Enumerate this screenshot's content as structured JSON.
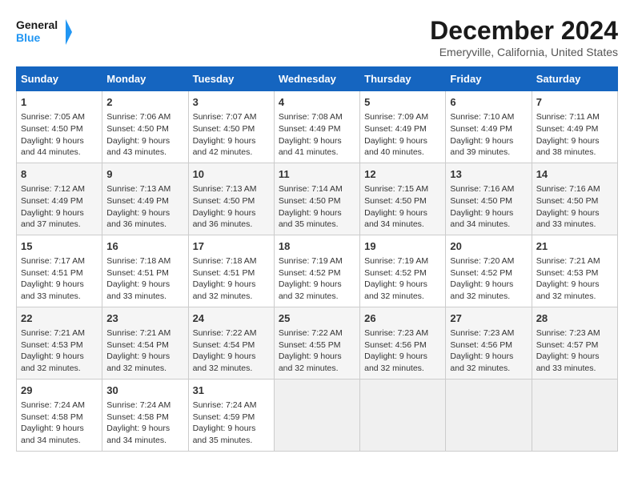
{
  "header": {
    "logo_line1": "General",
    "logo_line2": "Blue",
    "title": "December 2024",
    "subtitle": "Emeryville, California, United States"
  },
  "columns": [
    "Sunday",
    "Monday",
    "Tuesday",
    "Wednesday",
    "Thursday",
    "Friday",
    "Saturday"
  ],
  "weeks": [
    [
      {
        "day": "1",
        "info": "Sunrise: 7:05 AM\nSunset: 4:50 PM\nDaylight: 9 hours\nand 44 minutes."
      },
      {
        "day": "2",
        "info": "Sunrise: 7:06 AM\nSunset: 4:50 PM\nDaylight: 9 hours\nand 43 minutes."
      },
      {
        "day": "3",
        "info": "Sunrise: 7:07 AM\nSunset: 4:50 PM\nDaylight: 9 hours\nand 42 minutes."
      },
      {
        "day": "4",
        "info": "Sunrise: 7:08 AM\nSunset: 4:49 PM\nDaylight: 9 hours\nand 41 minutes."
      },
      {
        "day": "5",
        "info": "Sunrise: 7:09 AM\nSunset: 4:49 PM\nDaylight: 9 hours\nand 40 minutes."
      },
      {
        "day": "6",
        "info": "Sunrise: 7:10 AM\nSunset: 4:49 PM\nDaylight: 9 hours\nand 39 minutes."
      },
      {
        "day": "7",
        "info": "Sunrise: 7:11 AM\nSunset: 4:49 PM\nDaylight: 9 hours\nand 38 minutes."
      }
    ],
    [
      {
        "day": "8",
        "info": "Sunrise: 7:12 AM\nSunset: 4:49 PM\nDaylight: 9 hours\nand 37 minutes."
      },
      {
        "day": "9",
        "info": "Sunrise: 7:13 AM\nSunset: 4:49 PM\nDaylight: 9 hours\nand 36 minutes."
      },
      {
        "day": "10",
        "info": "Sunrise: 7:13 AM\nSunset: 4:50 PM\nDaylight: 9 hours\nand 36 minutes."
      },
      {
        "day": "11",
        "info": "Sunrise: 7:14 AM\nSunset: 4:50 PM\nDaylight: 9 hours\nand 35 minutes."
      },
      {
        "day": "12",
        "info": "Sunrise: 7:15 AM\nSunset: 4:50 PM\nDaylight: 9 hours\nand 34 minutes."
      },
      {
        "day": "13",
        "info": "Sunrise: 7:16 AM\nSunset: 4:50 PM\nDaylight: 9 hours\nand 34 minutes."
      },
      {
        "day": "14",
        "info": "Sunrise: 7:16 AM\nSunset: 4:50 PM\nDaylight: 9 hours\nand 33 minutes."
      }
    ],
    [
      {
        "day": "15",
        "info": "Sunrise: 7:17 AM\nSunset: 4:51 PM\nDaylight: 9 hours\nand 33 minutes."
      },
      {
        "day": "16",
        "info": "Sunrise: 7:18 AM\nSunset: 4:51 PM\nDaylight: 9 hours\nand 33 minutes."
      },
      {
        "day": "17",
        "info": "Sunrise: 7:18 AM\nSunset: 4:51 PM\nDaylight: 9 hours\nand 32 minutes."
      },
      {
        "day": "18",
        "info": "Sunrise: 7:19 AM\nSunset: 4:52 PM\nDaylight: 9 hours\nand 32 minutes."
      },
      {
        "day": "19",
        "info": "Sunrise: 7:19 AM\nSunset: 4:52 PM\nDaylight: 9 hours\nand 32 minutes."
      },
      {
        "day": "20",
        "info": "Sunrise: 7:20 AM\nSunset: 4:52 PM\nDaylight: 9 hours\nand 32 minutes."
      },
      {
        "day": "21",
        "info": "Sunrise: 7:21 AM\nSunset: 4:53 PM\nDaylight: 9 hours\nand 32 minutes."
      }
    ],
    [
      {
        "day": "22",
        "info": "Sunrise: 7:21 AM\nSunset: 4:53 PM\nDaylight: 9 hours\nand 32 minutes."
      },
      {
        "day": "23",
        "info": "Sunrise: 7:21 AM\nSunset: 4:54 PM\nDaylight: 9 hours\nand 32 minutes."
      },
      {
        "day": "24",
        "info": "Sunrise: 7:22 AM\nSunset: 4:54 PM\nDaylight: 9 hours\nand 32 minutes."
      },
      {
        "day": "25",
        "info": "Sunrise: 7:22 AM\nSunset: 4:55 PM\nDaylight: 9 hours\nand 32 minutes."
      },
      {
        "day": "26",
        "info": "Sunrise: 7:23 AM\nSunset: 4:56 PM\nDaylight: 9 hours\nand 32 minutes."
      },
      {
        "day": "27",
        "info": "Sunrise: 7:23 AM\nSunset: 4:56 PM\nDaylight: 9 hours\nand 32 minutes."
      },
      {
        "day": "28",
        "info": "Sunrise: 7:23 AM\nSunset: 4:57 PM\nDaylight: 9 hours\nand 33 minutes."
      }
    ],
    [
      {
        "day": "29",
        "info": "Sunrise: 7:24 AM\nSunset: 4:58 PM\nDaylight: 9 hours\nand 34 minutes."
      },
      {
        "day": "30",
        "info": "Sunrise: 7:24 AM\nSunset: 4:58 PM\nDaylight: 9 hours\nand 34 minutes."
      },
      {
        "day": "31",
        "info": "Sunrise: 7:24 AM\nSunset: 4:59 PM\nDaylight: 9 hours\nand 35 minutes."
      },
      {
        "day": "",
        "info": ""
      },
      {
        "day": "",
        "info": ""
      },
      {
        "day": "",
        "info": ""
      },
      {
        "day": "",
        "info": ""
      }
    ]
  ]
}
